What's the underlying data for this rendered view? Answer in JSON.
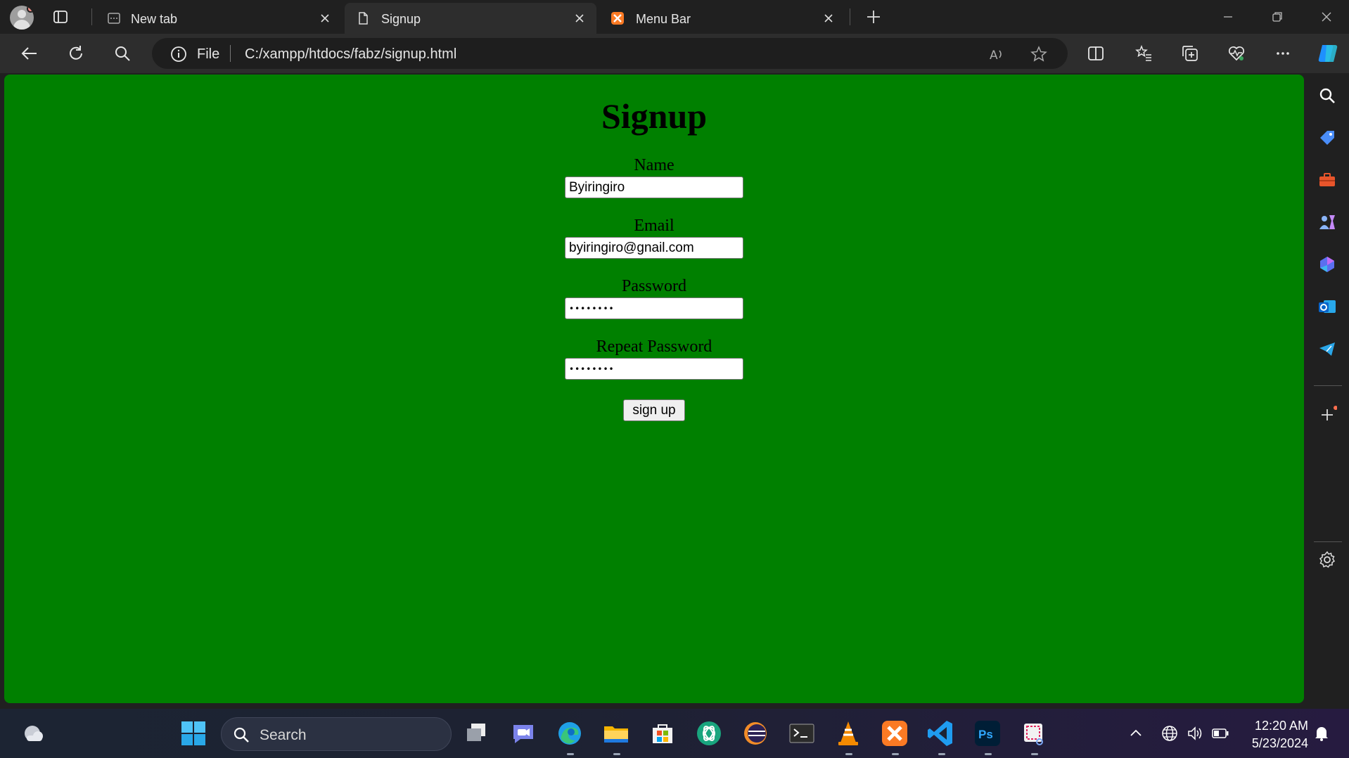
{
  "browser": {
    "tabs": [
      {
        "label": "New tab",
        "active": false
      },
      {
        "label": "Signup",
        "active": true
      },
      {
        "label": "Menu Bar",
        "active": false
      }
    ],
    "address": {
      "scheme_label": "File",
      "url": "C:/xampp/htdocs/fabz/signup.html"
    }
  },
  "page": {
    "background": "#008000",
    "title": "Signup",
    "fields": [
      {
        "label": "Name",
        "value": "Byiringiro",
        "type": "text"
      },
      {
        "label": "Email",
        "value": "byiringiro@gnail.com",
        "type": "text"
      },
      {
        "label": "Password",
        "value": "••••••••",
        "type": "password"
      },
      {
        "label": "Repeat Password",
        "value": "••••••••",
        "type": "password"
      }
    ],
    "submit_label": "sign up"
  },
  "sidebar": {
    "icons": [
      "search-icon",
      "shopping-tag-icon",
      "toolbox-icon",
      "games-icon",
      "copilot-icon",
      "outlook-icon",
      "telegram-icon",
      "add-icon",
      "settings-icon"
    ]
  },
  "taskbar": {
    "search_placeholder": "Search",
    "time": "12:20 AM",
    "date": "5/23/2024"
  },
  "colors": {
    "accent": "#008000",
    "chrome_dark": "#202020",
    "tab_active": "#2d2d2d"
  }
}
